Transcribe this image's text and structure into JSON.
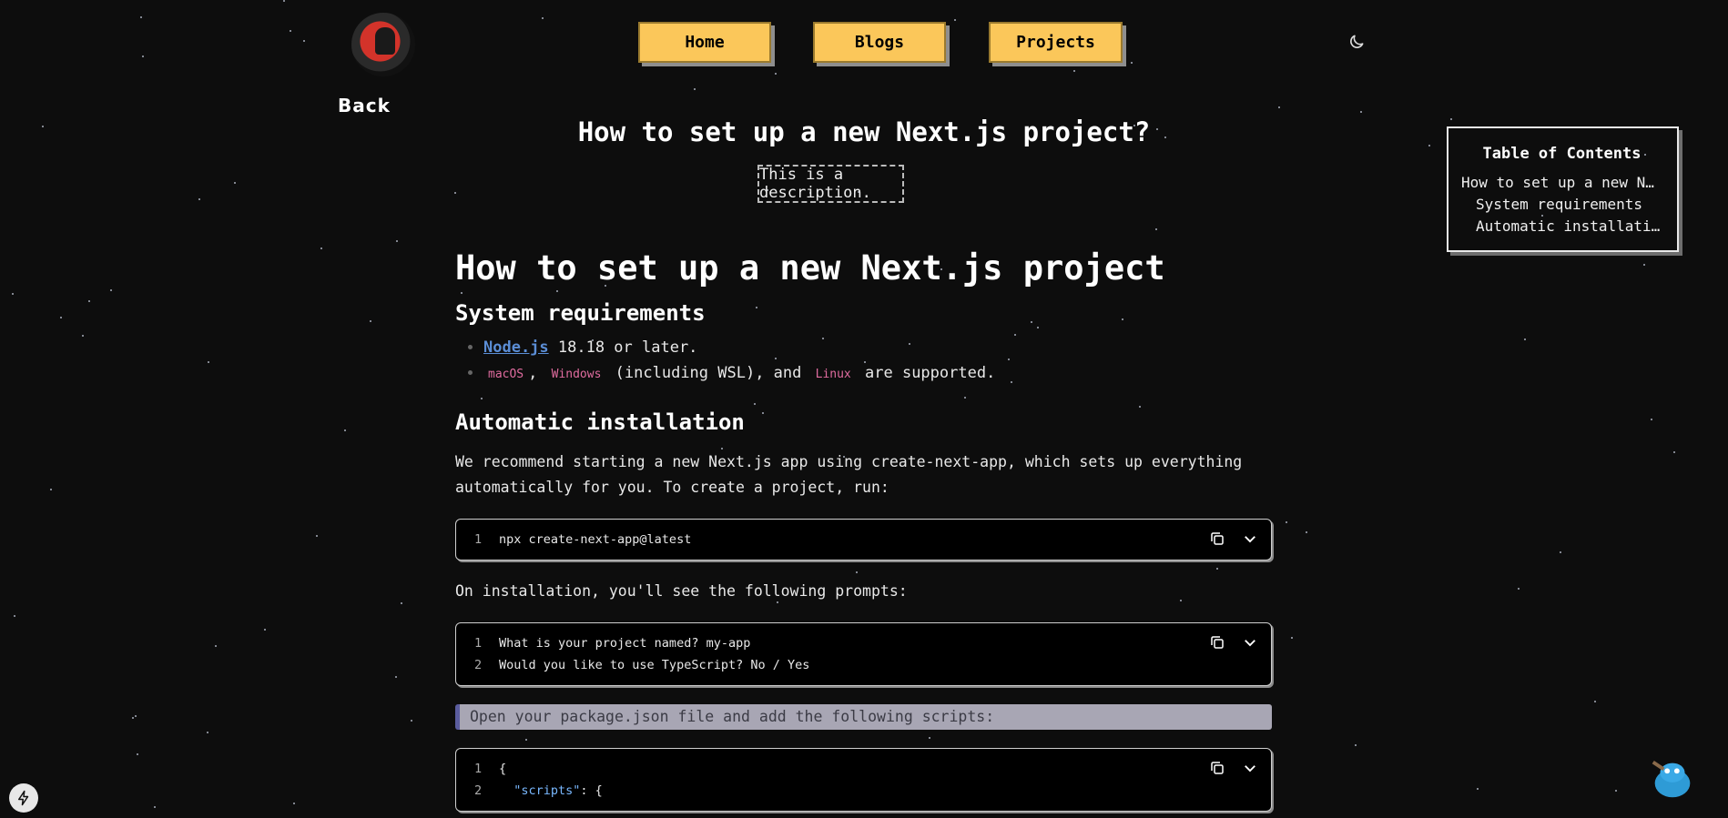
{
  "nav": {
    "home": "Home",
    "blogs": "Blogs",
    "projects": "Projects",
    "back": "Back",
    "theme_icon": "moon-icon"
  },
  "post": {
    "title": "How to set up a new Next.js project?",
    "description": "This is a description."
  },
  "toc": {
    "title": "Table of Contents",
    "items": [
      {
        "label": "How to set up a new Next.js project"
      },
      {
        "label": "System requirements"
      },
      {
        "label": "Automatic installation"
      }
    ]
  },
  "article": {
    "h1": "How to set up a new Next.js project",
    "sys_heading": "System requirements",
    "req1_link": "Node.js",
    "req1_text": " 18.18 or later.",
    "os_macos": "macOS",
    "os_windows": "Windows",
    "os_wsl": "(including WSL), and",
    "os_linux": "Linux",
    "os_tail": "are supported.",
    "auto_heading": "Automatic installation",
    "auto_para": "We recommend starting a new Next.js app using create-next-app, which sets up everything automatically for you. To create a project, run:",
    "code1": [
      {
        "n": "1",
        "text": "npx create-next-app@latest"
      }
    ],
    "prompts_para": "On installation, you'll see the following prompts:",
    "code2": [
      {
        "n": "1",
        "text": "What is your project named? my-app"
      },
      {
        "n": "2",
        "text": "Would you like to use TypeScript? No / Yes"
      }
    ],
    "quote": "Open your package.json file and add the following scripts:",
    "code3": [
      {
        "n": "1",
        "text": "{"
      },
      {
        "n": "2",
        "key": "\"scripts\"",
        "text": ": {"
      }
    ]
  },
  "icons": {
    "copy": "copy-icon",
    "expand": "chevron-down-icon",
    "bolt": "bolt-icon",
    "mascot": "mascot-icon"
  },
  "colors": {
    "nav_button": "#fbc75a",
    "link": "#5b8ed6",
    "inline_code": "#e06c9f",
    "background": "#0d0d0d"
  }
}
